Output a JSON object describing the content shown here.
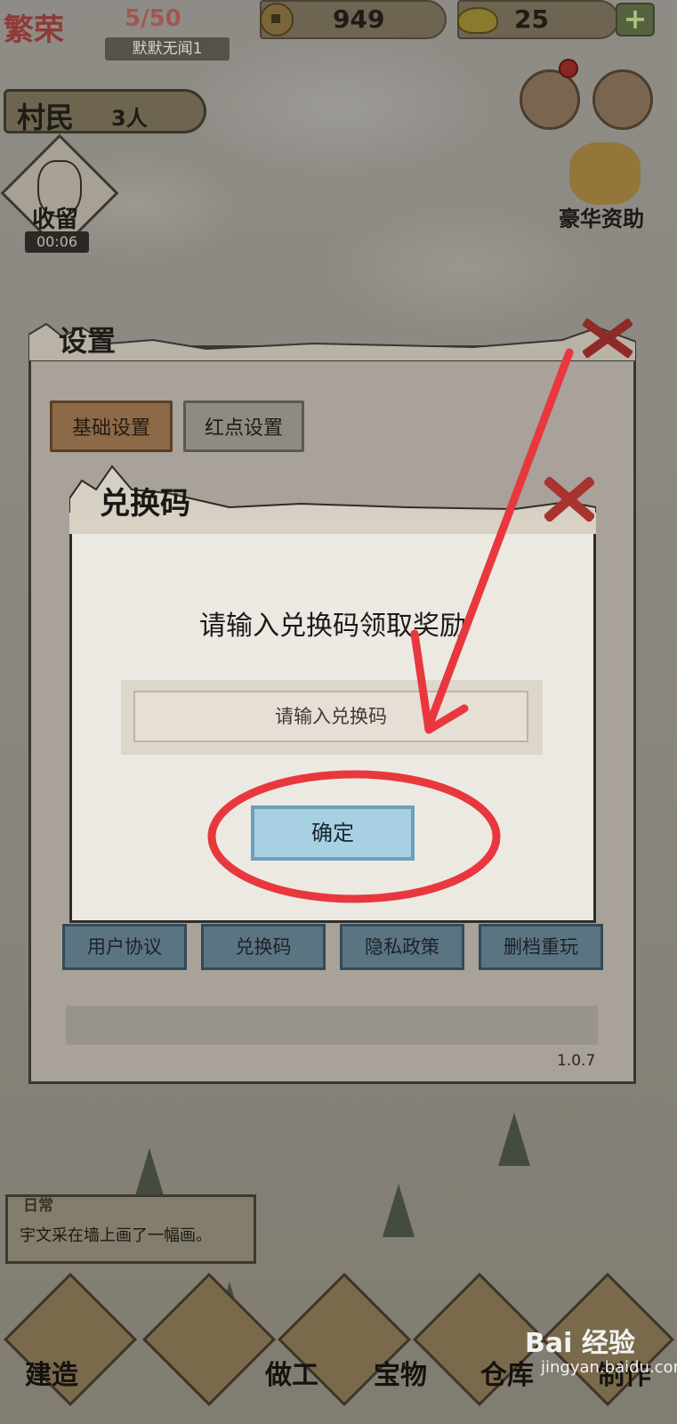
{
  "hud": {
    "title": "繁荣",
    "population": "5/50",
    "place_name": "默默无闻1",
    "copper_coins": "949",
    "gold_ingots": "25",
    "add_symbol": "+",
    "villagers_label": "村民",
    "villagers_count": "3人"
  },
  "side": {
    "take_in_label": "收留",
    "take_in_timer": "00:06",
    "deluxe_support_label": "豪华资助"
  },
  "settings": {
    "title": "设置",
    "tabs": [
      {
        "label": "基础设置",
        "active": true
      },
      {
        "label": "红点设置",
        "active": false
      }
    ],
    "buttons": [
      "用户协议",
      "兑换码",
      "隐私政策",
      "删档重玩"
    ],
    "version": "1.0.7"
  },
  "redeem": {
    "title": "兑换码",
    "prompt": "请输入兑换码领取奖励",
    "input_placeholder": "请输入兑换码",
    "input_value": "",
    "confirm_label": "确定"
  },
  "event": {
    "tag": "日常",
    "message": "宇文采在墙上画了一幅画。"
  },
  "bottom_nav": [
    "建造",
    "做工",
    "宝物",
    "仓库",
    "制作"
  ],
  "watermark": {
    "brand": "Bai 经验",
    "url": "jingyan.baidu.com"
  },
  "colors": {
    "annotation_red": "#e8383d",
    "confirm_fill": "#a8d0e3",
    "dialog_bg": "#ece9e3"
  }
}
